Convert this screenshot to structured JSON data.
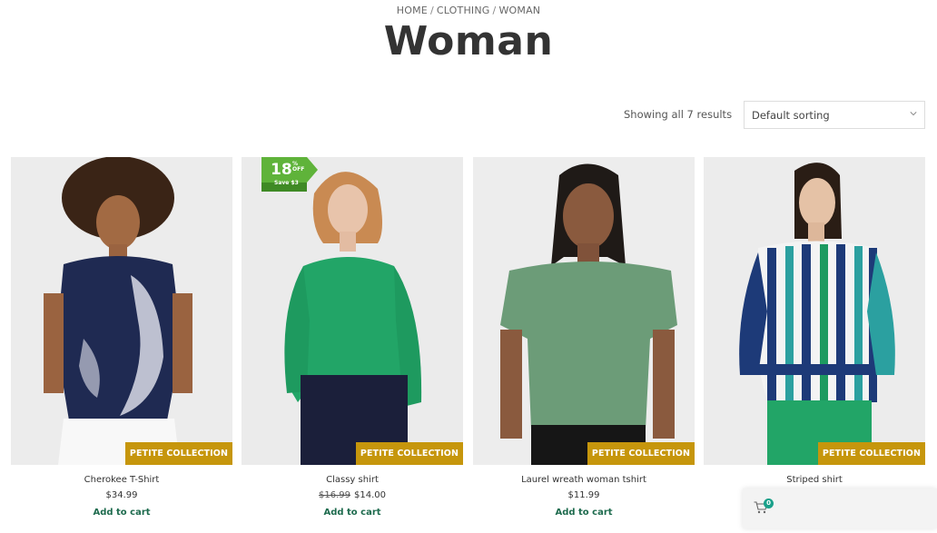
{
  "breadcrumb": {
    "items": [
      "HOME",
      "CLOTHING",
      "WOMAN"
    ],
    "separator": "/"
  },
  "page_title": "Woman",
  "toolbar": {
    "result_count": "Showing all 7 results",
    "sort_selected": "Default sorting"
  },
  "products": [
    {
      "title": "Cherokee T-Shirt",
      "price": "$34.99",
      "old_price": "",
      "add_to_cart": "Add to cart",
      "badge": "PETITE COLLECTION"
    },
    {
      "title": "Classy shirt",
      "price": "$14.00",
      "old_price": "$16.99",
      "add_to_cart": "Add to cart",
      "badge": "PETITE COLLECTION",
      "sale": {
        "percent": "18",
        "symbol": "%",
        "off": "OFF",
        "save": "Save $3"
      }
    },
    {
      "title": "Laurel wreath woman tshirt",
      "price": "$11.99",
      "old_price": "",
      "add_to_cart": "Add to cart",
      "badge": "PETITE COLLECTION"
    },
    {
      "title": "Striped shirt",
      "price": "",
      "old_price": "",
      "add_to_cart": "",
      "badge": "PETITE COLLECTION"
    }
  ],
  "mini_cart": {
    "count": "0",
    "icon": "cart-icon"
  },
  "colors": {
    "collection_badge": "#c6960c",
    "sale_badge": "#5fb33a",
    "add_to_cart": "#1e6b4e",
    "cart_count": "#1aa08a"
  }
}
